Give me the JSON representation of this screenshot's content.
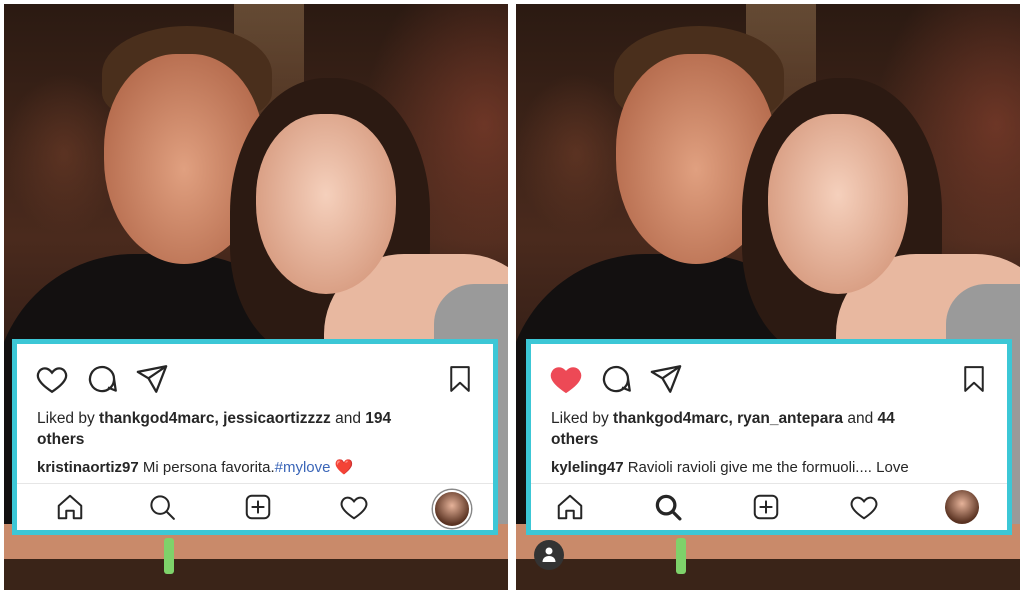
{
  "left_post": {
    "liked_prefix": "Liked by ",
    "liked_users": "thankgod4marc, jessicaortizzzz",
    "liked_and": " and ",
    "liked_count": "194",
    "liked_others": "others",
    "caption_user": "kristinaortiz97",
    "caption_text": " Mi persona favorita.",
    "caption_hashtag": "#mylove",
    "caption_emoji": " ❤️",
    "liked_state": "not-liked"
  },
  "right_post": {
    "liked_prefix": "Liked by ",
    "liked_users": "thankgod4marc, ryan_antepara",
    "liked_and": " and ",
    "liked_count": "44",
    "liked_others": "others",
    "caption_user": "kyleling47",
    "caption_text": " Ravioli ravioli give me the formuoli.... Love",
    "liked_state": "liked"
  },
  "colors": {
    "frame_border": "#3cc7d6",
    "liked_heart": "#ed4956",
    "hashtag": "#3b66b8"
  },
  "icons": {
    "actions": [
      "heart-icon",
      "comment-icon",
      "share-icon",
      "bookmark-icon"
    ],
    "nav": [
      "home-icon",
      "search-icon",
      "add-post-icon",
      "activity-heart-icon",
      "profile-avatar"
    ]
  }
}
